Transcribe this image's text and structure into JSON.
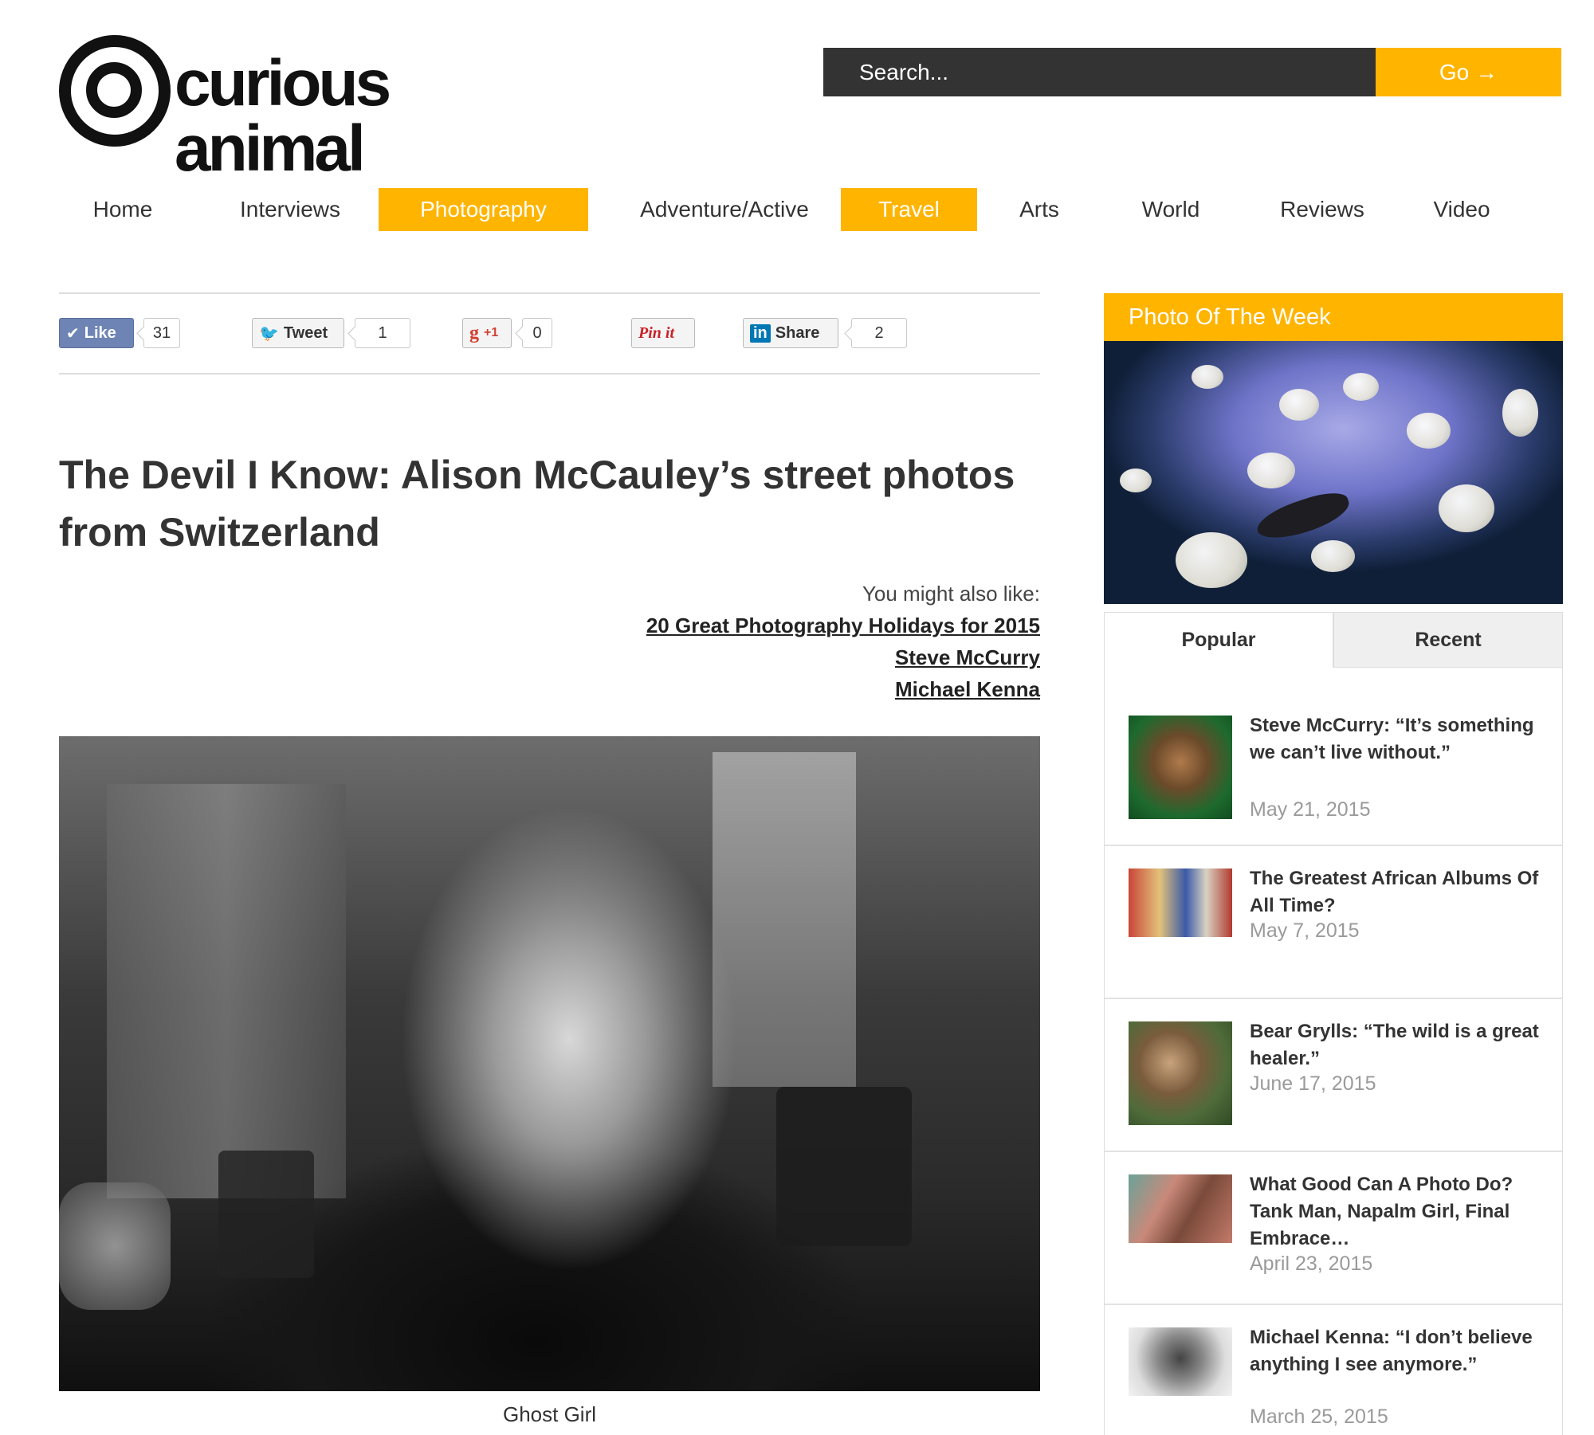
{
  "brand": {
    "name": "curious animal"
  },
  "search": {
    "placeholder": "Search...",
    "button_label": "Go",
    "button_arrow": "→"
  },
  "nav": {
    "items": [
      {
        "label": "Home",
        "active": false
      },
      {
        "label": "Interviews",
        "active": false
      },
      {
        "label": "Photography",
        "active": true
      },
      {
        "label": "Adventure/Active",
        "active": false
      },
      {
        "label": "Travel",
        "active": true
      },
      {
        "label": "Arts",
        "active": false
      },
      {
        "label": "World",
        "active": false
      },
      {
        "label": "Reviews",
        "active": false
      },
      {
        "label": "Video",
        "active": false
      }
    ]
  },
  "share": {
    "facebook": {
      "label": "Like",
      "count": "31"
    },
    "twitter": {
      "label": "Tweet",
      "count": "1"
    },
    "gplus": {
      "label": "+1",
      "count": "0"
    },
    "pinterest": {
      "label": "Pin it"
    },
    "linkedin": {
      "label": "Share",
      "count": "2"
    }
  },
  "article": {
    "title": "The Devil I Know: Alison McCauley’s street photos from Switzerland",
    "also_like_label": "You might also like:",
    "also_like_links": [
      "20 Great Photography Holidays for 2015",
      "Steve McCurry",
      "Michael Kenna"
    ],
    "image_caption": "Ghost Girl"
  },
  "sidebar": {
    "photo_of_week_title": "Photo Of The Week",
    "tabs": [
      {
        "label": "Popular",
        "active": true
      },
      {
        "label": "Recent",
        "active": false
      }
    ],
    "popular": [
      {
        "title": "Steve McCurry: “It’s something we can’t live without.”",
        "date": "May 21, 2015"
      },
      {
        "title": "The Greatest African Albums Of All Time?",
        "date": "May 7, 2015"
      },
      {
        "title": "Bear Grylls: “The wild is a great healer.”",
        "date": "June 17, 2015"
      },
      {
        "title": "What Good Can A Photo Do? Tank Man, Napalm Girl, Final Embrace…",
        "date": "April 23, 2015"
      },
      {
        "title": "Michael Kenna: “I don’t believe anything I see anymore.”",
        "date": "March 25, 2015"
      }
    ]
  },
  "colors": {
    "accent": "#ffb400",
    "search_bg": "#333333",
    "text": "#333333",
    "muted": "#9a9a9a"
  }
}
